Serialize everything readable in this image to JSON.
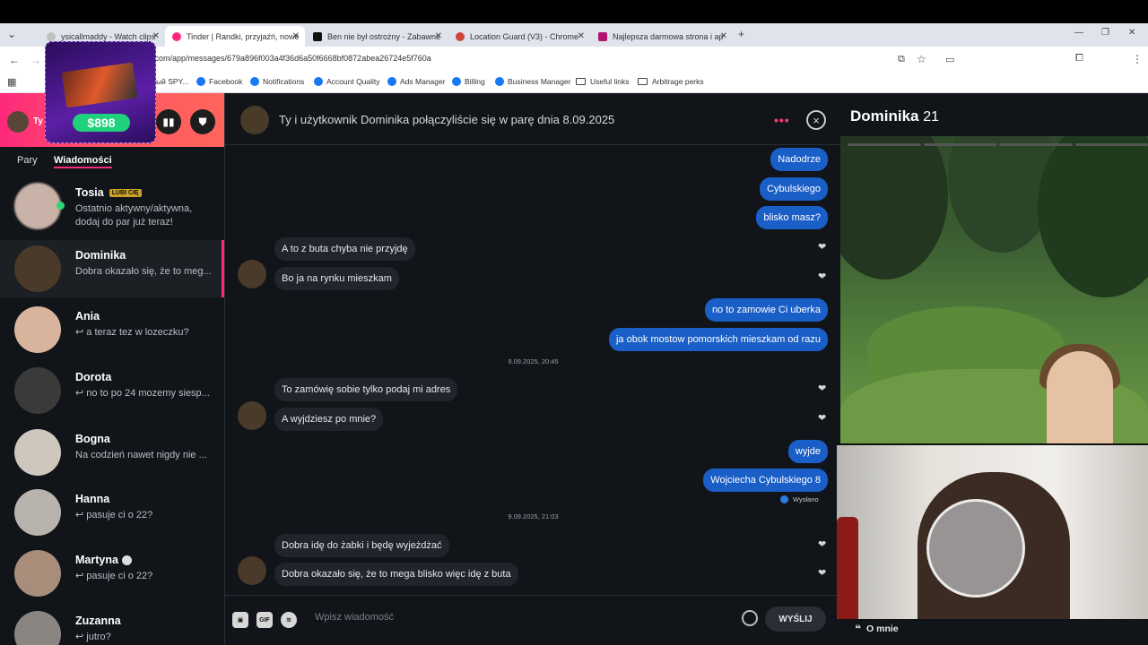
{
  "browser": {
    "tabs": [
      {
        "title": "ysicallmaddy - Watch clips",
        "icon_color": "#c0c0c0"
      },
      {
        "title": "Tinder | Randki, przyjaźń, nowe",
        "icon_color": "#fd297b"
      },
      {
        "title": "Ben nie był ostrożny - Zabawne",
        "icon_color": "#111111"
      },
      {
        "title": "Location Guard (V3) - Chrome",
        "icon_color": "#d0433b"
      },
      {
        "title": "Najlepsza darmowa strona i ap",
        "icon_color": "#b3126e"
      }
    ],
    "new_tab": "+",
    "url": ".com/app/messages/679a896f003a4f36d6a50f6668bf0872abea26724e5f760a",
    "bookmarks": [
      {
        "label": "ый SPY...",
        "type": "text"
      },
      {
        "label": "Facebook",
        "type": "fb"
      },
      {
        "label": "Notifications",
        "type": "fb"
      },
      {
        "label": "Account Quality",
        "type": "fb"
      },
      {
        "label": "Ads Manager",
        "type": "fb"
      },
      {
        "label": "Billing",
        "type": "fb"
      },
      {
        "label": "Business Manager",
        "type": "fb"
      },
      {
        "label": "Useful links",
        "type": "folder"
      },
      {
        "label": "Arbitrage perks",
        "type": "folder"
      }
    ]
  },
  "sidebar": {
    "user_short": "Ty",
    "promo_price": "$898",
    "tabs": [
      "Pary",
      "Wiadomości"
    ],
    "conversations": [
      {
        "name": "Tosia",
        "badge": "LUBI CIĘ",
        "preview": "Ostatnio aktywny/aktywna, dodaj do par już teraz!",
        "online": true,
        "avatar_color": "#c9b3a8"
      },
      {
        "name": "Dominika",
        "preview": "Dobra okazało się, że to meg...",
        "selected": true,
        "avatar_color": "#4a3a2a"
      },
      {
        "name": "Ania",
        "preview": "↩ a teraz tez w lozeczku?",
        "avatar_color": "#d9b49c"
      },
      {
        "name": "Dorota",
        "preview": "↩ no to po 24 mozemy siesp...",
        "avatar_color": "#3a3a3a"
      },
      {
        "name": "Bogna",
        "preview": "Na codzień nawet nigdy nie ...",
        "avatar_color": "#cfc6bd"
      },
      {
        "name": "Hanna",
        "preview": "↩ pasuje ci o 22?",
        "avatar_color": "#b9b3ad"
      },
      {
        "name": "Martyna",
        "preview": "↩ pasuje ci o 22?",
        "verified": true,
        "avatar_color": "#a88d7a"
      },
      {
        "name": "Zuzanna",
        "preview": "↩ jutro?",
        "avatar_color": "#8a8580"
      }
    ]
  },
  "chat": {
    "header_title": "Ty i użytkownik Dominika połączyliście się w parę dnia 8.09.2025",
    "menu_dots": "•••",
    "close_glyph": "×",
    "messages": [
      {
        "dir": "out",
        "text": "Nadodrze"
      },
      {
        "dir": "out",
        "text": "Cybulskiego"
      },
      {
        "dir": "out",
        "text": "blisko masz?"
      },
      {
        "dir": "in",
        "text": "A to z buta chyba nie przyjdę"
      },
      {
        "dir": "in",
        "text": "Bo ja na rynku mieszkam"
      },
      {
        "dir": "out",
        "text": "no to zamowie Ci uberka"
      },
      {
        "dir": "out",
        "text": "ja obok mostow pomorskich mieszkam od razu"
      },
      {
        "dir": "in",
        "text": "To zamówię sobie tylko podaj mi adres"
      },
      {
        "dir": "in",
        "text": "A wyjdziesz po mnie?"
      },
      {
        "dir": "out",
        "text": "wyjde"
      },
      {
        "dir": "out",
        "text": "Wojciecha Cybulskiego 8"
      },
      {
        "dir": "in",
        "text": "Dobra idę do żabki i będę wyjeżdżać"
      },
      {
        "dir": "in",
        "text": "Dobra okazało się, że to mega blisko więc idę z buta"
      }
    ],
    "timestamps": [
      "9.09.2025, 20:45",
      "9.09.2025, 21:03"
    ],
    "sent_label": "Wysłano",
    "composer_placeholder": "Wpisz wiadomość",
    "gif_label": "GIF",
    "send_label": "WYŚLIJ"
  },
  "profile": {
    "name": "Dominika",
    "age": "21",
    "about_label": "O mnie"
  },
  "colors": {
    "brand": "#fd297b",
    "outgoing_bubble": "#1a5ec7",
    "incoming_bubble": "#20242b",
    "background": "#111418"
  }
}
